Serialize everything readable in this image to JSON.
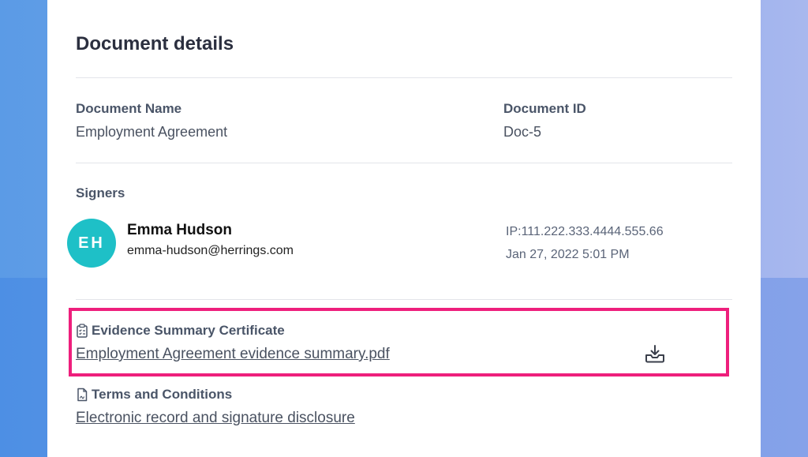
{
  "panel": {
    "title": "Document details"
  },
  "document": {
    "name_label": "Document Name",
    "name_value": "Employment Agreement",
    "id_label": "Document ID",
    "id_value": "Doc-5"
  },
  "signers": {
    "label": "Signers",
    "items": [
      {
        "initials": "EH",
        "name": "Emma Hudson",
        "email": "emma-hudson@herrings.com",
        "ip": "IP:111.222.333.4444.555.66",
        "timestamp": "Jan 27, 2022 5:01 PM",
        "avatar_color": "#1ec0c7"
      }
    ]
  },
  "evidence": {
    "heading": "Evidence Summary Certificate",
    "link_text": "Employment Agreement evidence summary.pdf",
    "icon": "clipboard-checklist-icon",
    "action_icon": "download-tray-icon",
    "highlight_color": "#ee1f7c"
  },
  "terms": {
    "heading": "Terms and Conditions",
    "link_text": "Electronic record and signature disclosure",
    "icon": "document-icon"
  }
}
